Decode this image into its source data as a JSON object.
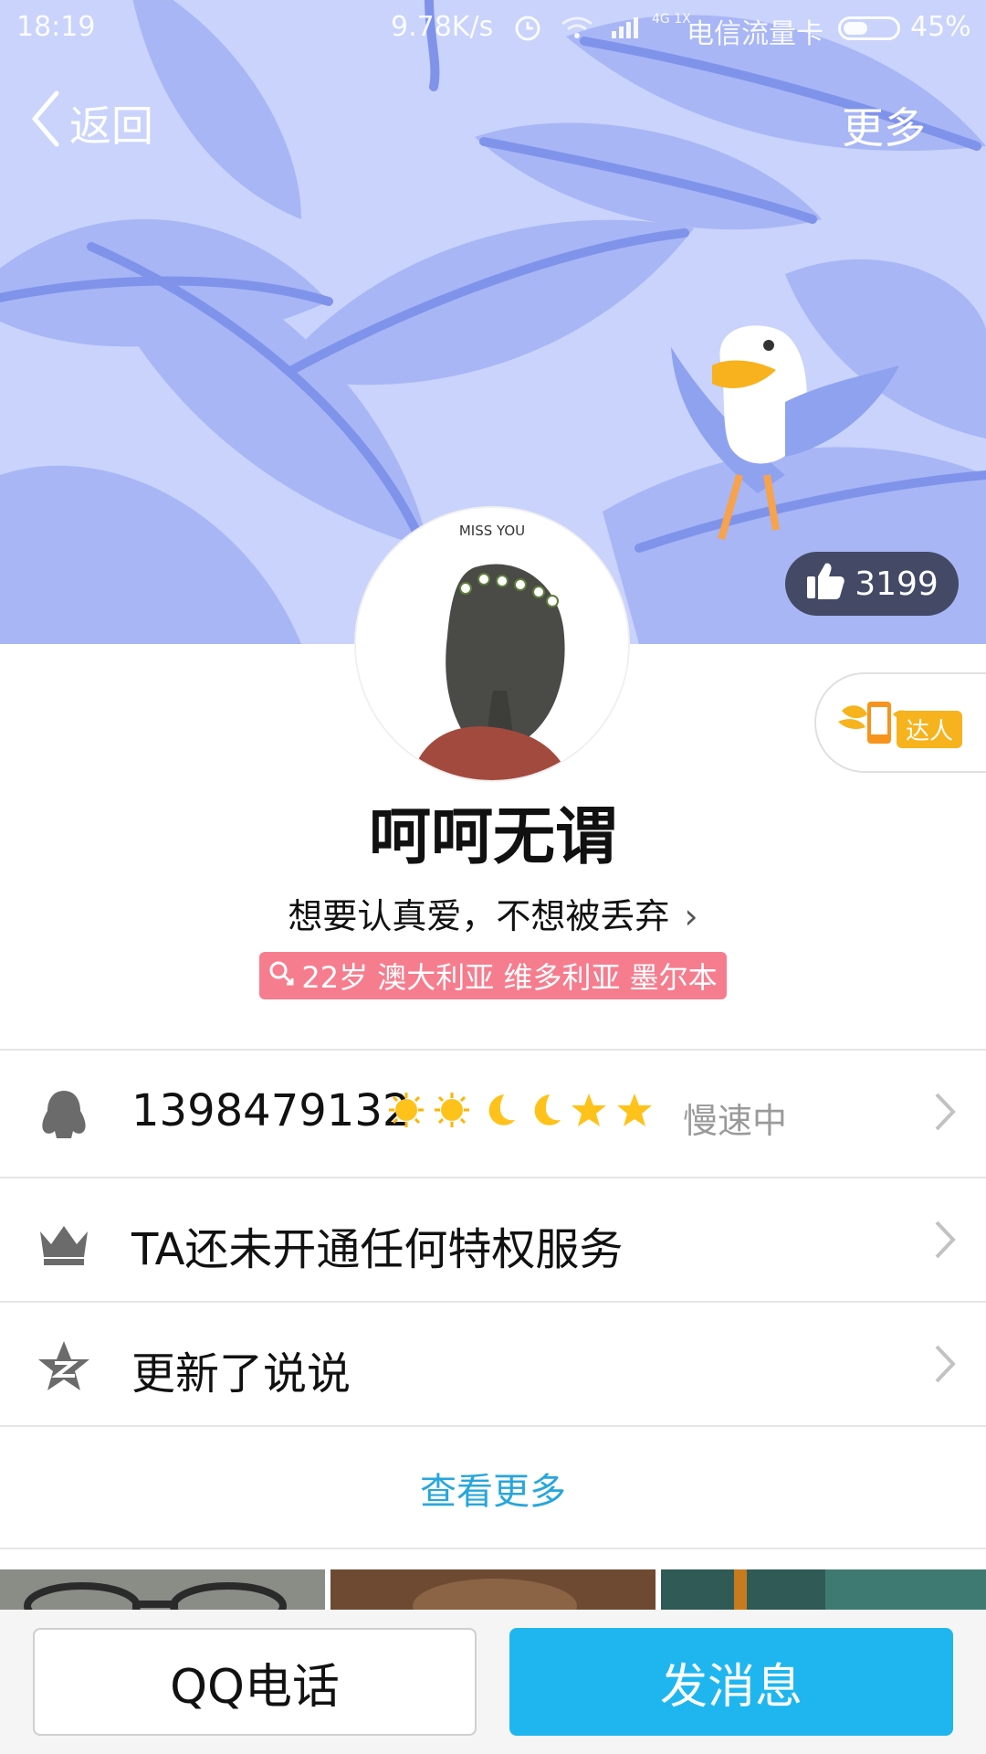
{
  "status_bar": {
    "time": "18:19",
    "net_speed": "9.78K/s",
    "network_type": "4G 1X",
    "carrier": "电信流量卡",
    "battery": "45%",
    "icons": [
      "alarm-icon",
      "wifi-icon",
      "signal-icon",
      "battery-icon"
    ]
  },
  "nav": {
    "back_label": "返回",
    "more_label": "更多"
  },
  "cover": {
    "likes": "3199",
    "colors": {
      "bg": "#c9d3fb",
      "leaf": "#9fb0f4",
      "leaf_dark": "#7f93ea"
    }
  },
  "avatar": {
    "caption": "MISS YOU"
  },
  "badge": {
    "label": "达人"
  },
  "profile": {
    "nickname": "呵呵无谓",
    "signature": "想要认真爱，不想被丢弃",
    "info": "22岁 澳大利亚 维多利亚 墨尔本"
  },
  "rows": [
    {
      "icon": "penguin-icon",
      "text": "1398479132",
      "level_icons": [
        "sun-icon",
        "sun-icon",
        "moon-icon",
        "moon-icon",
        "star-icon",
        "star-icon"
      ],
      "status": "慢速中"
    },
    {
      "icon": "crown-icon",
      "text": "TA还未开通任何特权服务"
    },
    {
      "icon": "qzone-star-icon",
      "text": "更新了说说"
    }
  ],
  "see_more": "查看更多",
  "bottom": {
    "call_label": "QQ电话",
    "message_label": "发消息"
  },
  "accent_colors": {
    "primary": "#1fb6f0",
    "link": "#27a6dc",
    "tag": "#f67d8e"
  }
}
